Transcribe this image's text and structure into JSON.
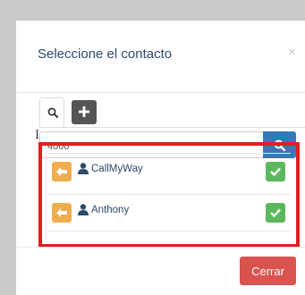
{
  "modal": {
    "title": "Seleccione el contacto",
    "close_symbol": "×"
  },
  "tabs": [
    {
      "icon": "search-icon"
    },
    {
      "icon": "plus-icon"
    }
  ],
  "search": {
    "value": "4000",
    "button_icon": "search-icon"
  },
  "contacts": [
    {
      "name": "CallMyWay",
      "left_icon": "arrow-left-icon",
      "right_icon": "check-icon"
    },
    {
      "name": "Anthony",
      "left_icon": "arrow-left-icon",
      "right_icon": "check-icon"
    }
  ],
  "footer": {
    "close_label": "Cerrar"
  },
  "colors": {
    "primary": "#337ab7",
    "warning": "#f0ad4e",
    "success": "#5cb85c",
    "danger": "#d9534f",
    "highlight": "#e01f1f"
  }
}
